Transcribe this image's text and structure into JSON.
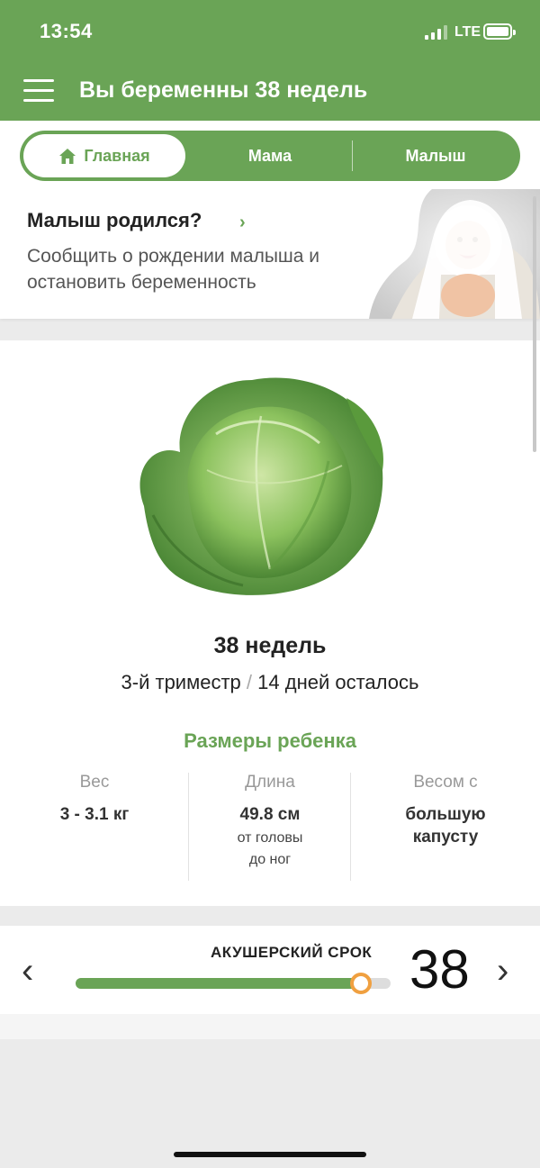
{
  "status": {
    "time": "13:54",
    "network": "LTE",
    "signal_icon": "signal-bars-icon",
    "battery_icon": "battery-icon"
  },
  "header": {
    "title": "Вы беременны 38 недель",
    "menu_icon": "hamburger-menu-icon",
    "color": "#6aa456"
  },
  "tabs": [
    {
      "label": "Главная",
      "icon": "home-icon",
      "active": true
    },
    {
      "label": "Мама",
      "active": false
    },
    {
      "label": "Малыш",
      "active": false
    }
  ],
  "born_card": {
    "title": "Малыш родился?",
    "description": "Сообщить о рождении малыша и остановить беременность",
    "chevron_icon": "chevron-right-icon",
    "image": "baby-photo"
  },
  "week_info": {
    "image": "cabbage-image",
    "weeks": "38 недель",
    "trimester": "3-й триместр",
    "separator": "/",
    "days_left": "14 дней осталось"
  },
  "sizes": {
    "title": "Размеры ребенка",
    "weight_label": "Вес",
    "weight_value": "3 - 3.1 кг",
    "length_label": "Длина",
    "length_value": "49.8 см",
    "length_sub1": "от головы",
    "length_sub2": "до ног",
    "compare_label": "Весом с",
    "compare_value1": "большую",
    "compare_value2": "капусту"
  },
  "week_selector": {
    "label": "АКУШЕРСКИЙ СРОК",
    "current_week": "38",
    "progress_fraction": 0.905,
    "prev_icon": "chevron-left-icon",
    "next_icon": "chevron-right-icon",
    "accent": "#f0a040"
  }
}
